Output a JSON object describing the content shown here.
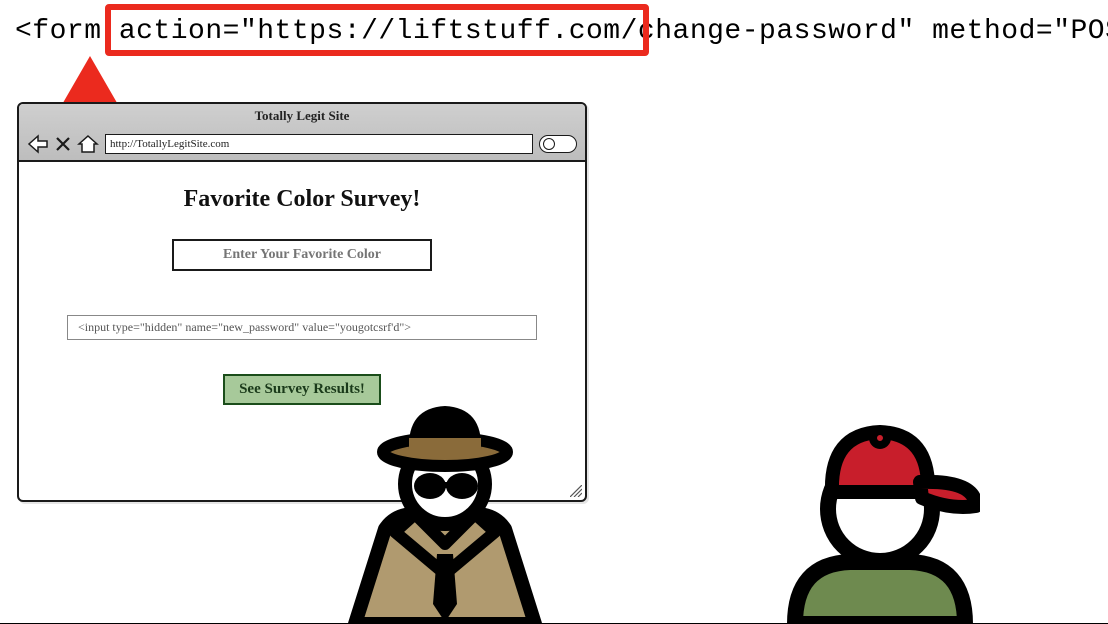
{
  "code": {
    "prefix": "<form ",
    "action": "action=\"https://liftstuff.com/change-password\"",
    "method": " method=\"POST\">"
  },
  "browser": {
    "title": "Totally Legit Site",
    "url": "http://TotallyLegitSite.com"
  },
  "survey": {
    "heading": "Favorite Color Survey!",
    "placeholder": "Enter Your Favorite Color",
    "hidden_input_code": "<input type=\"hidden\" name=\"new_password\" value=\"yougotcsrf'd\">",
    "button_label": "See Survey Results!"
  },
  "icons": {
    "back": "back-arrow-icon",
    "close": "close-x-icon",
    "home": "home-icon",
    "search": "search-icon",
    "arrow": "red-up-arrow-icon",
    "hacker": "hacker-spy-icon",
    "user": "user-cap-icon"
  },
  "colors": {
    "highlight": "#eb2a1e",
    "button_bg": "#a7c99a",
    "hat_brown": "#8a6b3a",
    "coat_tan": "#b09a6f",
    "cap_red": "#c81e2b",
    "shirt_olive": "#6e8a4f"
  }
}
